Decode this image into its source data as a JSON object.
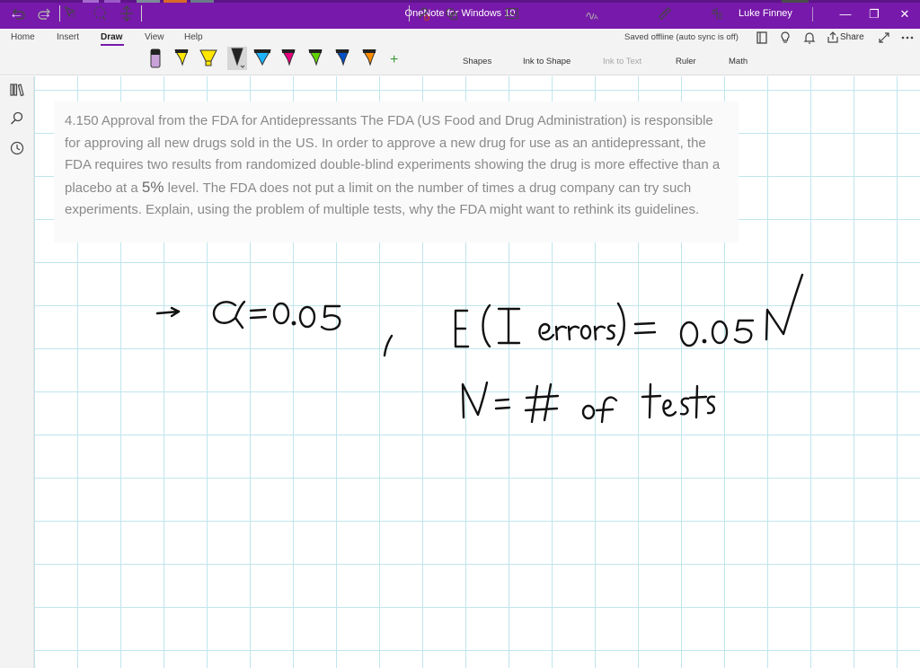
{
  "window": {
    "title": "OneNote for Windows 10",
    "user": "Luke Finney",
    "back_icon": "back-arrow-icon",
    "forward_icon": "forward-arrow-icon",
    "minimize_label": "—",
    "restore_label": "❐",
    "close_label": "✕"
  },
  "ribbon": {
    "tabs": [
      "Home",
      "Insert",
      "Draw",
      "View",
      "Help"
    ],
    "active_tab": "Draw",
    "sync_status": "Saved offline (auto sync is off)",
    "share_label": "Share",
    "accent_color": "#7719aa"
  },
  "toolbar": {
    "shapes_label": "Shapes",
    "ink_to_shape_label": "Ink to Shape",
    "ink_to_text_label": "Ink to Text",
    "ruler_label": "Ruler",
    "math_label": "Math",
    "add_pen_label": "+",
    "pen_colors": [
      "#c8a2d8",
      "#ffe600",
      "#ffe600",
      "#222222",
      "#1fb4ff",
      "#e6007e",
      "#5fd400",
      "#0050c8",
      "#ff8c00"
    ]
  },
  "question": {
    "before_pct": "4.150 Approval from the FDA for Antidepressants The FDA (US Food and Drug Administration) is responsible for approving all new drugs sold in the US. In order to approve a new drug for use as an antidepressant, the FDA requires two results from randomized double-blind experiments showing the drug is more effective than a placebo at a ",
    "pct": "5%",
    "after_pct": " level. The FDA does not put a limit on the number of times a drug company can try such experiments. Explain, using the problem of multiple tests, why the FDA might want to rethink its guidelines."
  },
  "handwriting": {
    "line1_left": "→ α = 0.05",
    "line1_right": "E(I errors) = 0.05N",
    "line2": "N = # of tests"
  }
}
